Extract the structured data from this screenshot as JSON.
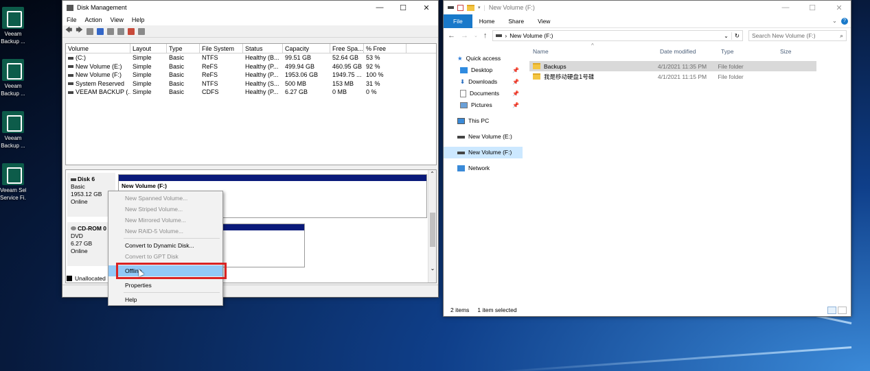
{
  "desktop": {
    "icons": [
      {
        "label1": "Veeam",
        "label2": "Backup ..."
      },
      {
        "label1": "Veeam",
        "label2": "Backup ..."
      },
      {
        "label1": "Veeam",
        "label2": "Backup ..."
      },
      {
        "label1": "Veeam Self",
        "label2": "Service Fi..."
      }
    ]
  },
  "disk_mgmt": {
    "title": "Disk Management",
    "menu": [
      "File",
      "Action",
      "View",
      "Help"
    ],
    "columns": [
      "Volume",
      "Layout",
      "Type",
      "File System",
      "Status",
      "Capacity",
      "Free Spa...",
      "% Free"
    ],
    "rows": [
      [
        "(C:)",
        "Simple",
        "Basic",
        "NTFS",
        "Healthy (B...",
        "99.51 GB",
        "52.64 GB",
        "53 %"
      ],
      [
        "New Volume (E:)",
        "Simple",
        "Basic",
        "ReFS",
        "Healthy (P...",
        "499.94 GB",
        "460.95 GB",
        "92 %"
      ],
      [
        "New Volume (F:)",
        "Simple",
        "Basic",
        "ReFS",
        "Healthy (P...",
        "1953.06 GB",
        "1949.75 ...",
        "100 %"
      ],
      [
        "System Reserved",
        "Simple",
        "Basic",
        "NTFS",
        "Healthy (S...",
        "500 MB",
        "153 MB",
        "31 %"
      ],
      [
        "VEEAM BACKUP (...",
        "Simple",
        "Basic",
        "CDFS",
        "Healthy (P...",
        "6.27 GB",
        "0 MB",
        "0 %"
      ]
    ],
    "disk6": {
      "name": "Disk 6",
      "type": "Basic",
      "size": "1953.12 GB",
      "state": "Online",
      "partition": "New Volume  (F:)"
    },
    "cdrom": {
      "name": "CD-ROM 0",
      "type": "DVD",
      "size": "6.27 GB",
      "state": "Online"
    },
    "legend": "Unallocated"
  },
  "context_menu": {
    "items": [
      {
        "label": "New Spanned Volume...",
        "disabled": true
      },
      {
        "label": "New Striped Volume...",
        "disabled": true
      },
      {
        "label": "New Mirrored Volume...",
        "disabled": true
      },
      {
        "label": "New RAID-5 Volume...",
        "disabled": true
      },
      {
        "label": "Convert to Dynamic Disk...",
        "disabled": false
      },
      {
        "label": "Convert to GPT Disk",
        "disabled": true
      },
      {
        "label": "Offline",
        "disabled": false,
        "highlighted": true
      },
      {
        "label": "Properties",
        "disabled": false
      },
      {
        "label": "Help",
        "disabled": false
      }
    ]
  },
  "explorer": {
    "title": "New Volume (F:)",
    "ribbon_tabs": [
      "File",
      "Home",
      "Share",
      "View"
    ],
    "address": "New Volume (F:)",
    "search_placeholder": "Search New Volume (F:)",
    "nav": [
      {
        "label": "Quick access",
        "icon": "star-icon"
      },
      {
        "label": "Desktop",
        "icon": "desktop-icon",
        "pinned": true
      },
      {
        "label": "Downloads",
        "icon": "download-icon",
        "pinned": true
      },
      {
        "label": "Documents",
        "icon": "document-icon",
        "pinned": true
      },
      {
        "label": "Pictures",
        "icon": "picture-icon",
        "pinned": true
      },
      {
        "label": "This PC",
        "icon": "computer-icon"
      },
      {
        "label": "New Volume (E:)",
        "icon": "drive-icon"
      },
      {
        "label": "New Volume (F:)",
        "icon": "drive-icon",
        "selected": true
      },
      {
        "label": "Network",
        "icon": "network-icon"
      }
    ],
    "columns": [
      "Name",
      "Date modified",
      "Type",
      "Size"
    ],
    "files": [
      {
        "name": "Backups",
        "date": "4/1/2021 11:35 PM",
        "type": "File folder",
        "size": ""
      },
      {
        "name": "我是移动硬盘1号碟",
        "date": "4/1/2021 11:15 PM",
        "type": "File folder",
        "size": ""
      }
    ],
    "status_count": "2 items",
    "status_selected": "1 item selected"
  },
  "colors": {
    "accent": "#1979ca",
    "highlight_border": "#d92323",
    "partition_stripe": "#0a1a7a"
  }
}
